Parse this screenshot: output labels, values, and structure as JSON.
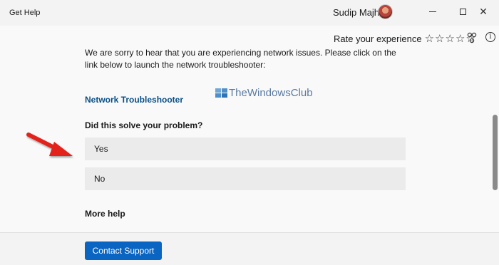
{
  "window": {
    "title": "Get Help",
    "user_name": "Sudip Majhi",
    "controls": {
      "minimize": "minimize-icon",
      "maximize": "maximize-icon",
      "close": "close-icon",
      "close_glyph": "✕"
    }
  },
  "rating": {
    "label": "Rate your experience",
    "stars": [
      "☆",
      "☆",
      "☆",
      "☆",
      "☆"
    ],
    "icons": [
      "share-icon",
      "info-icon"
    ],
    "info_glyph": "i"
  },
  "content": {
    "intro": "We are sorry to hear that you are experiencing network issues. Please click on the link below to launch the network troubleshooter:",
    "link_text": "Network Troubleshooter",
    "question": "Did this solve your problem?",
    "answers": {
      "yes": "Yes",
      "no": "No"
    },
    "more_help": "More help"
  },
  "watermark": {
    "text": "TheWindowsClub"
  },
  "footer": {
    "contact_button": "Contact Support"
  },
  "colors": {
    "link": "#0a4f86",
    "primary_button": "#0a64c2",
    "arrow": "#e3241b"
  }
}
